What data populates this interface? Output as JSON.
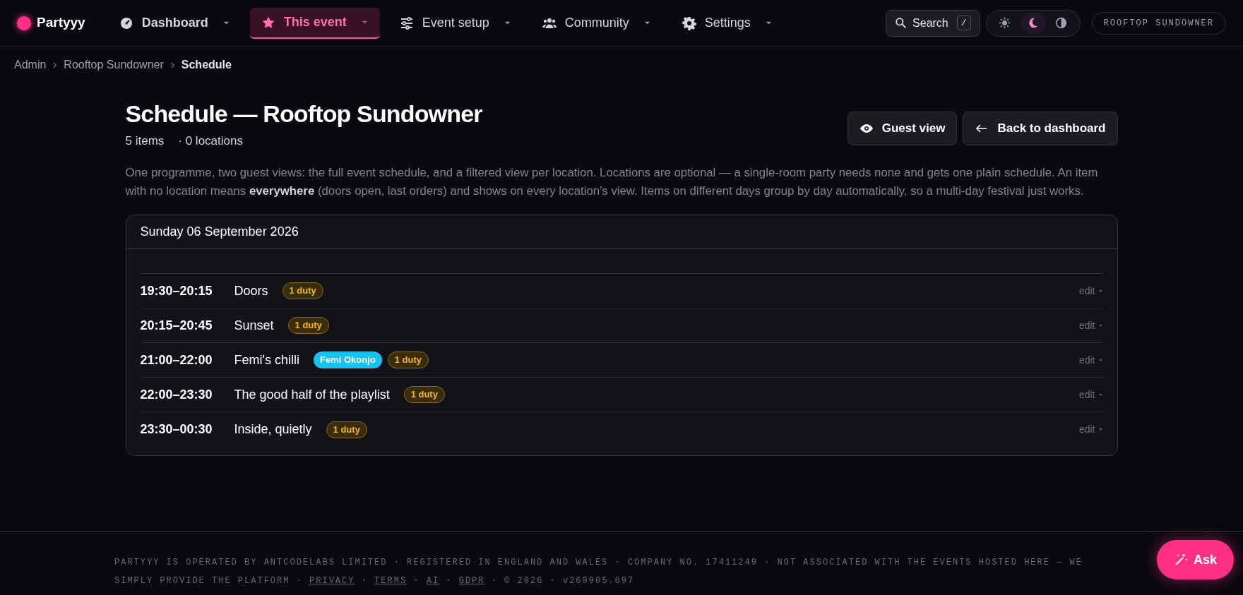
{
  "brand": {
    "name": "Partyyy"
  },
  "nav": [
    {
      "label": "Dashboard",
      "selected": false
    },
    {
      "label": "This event",
      "selected": true
    },
    {
      "label": "Event setup",
      "selected": false
    },
    {
      "label": "Community",
      "selected": false
    },
    {
      "label": "Settings",
      "selected": false
    }
  ],
  "search": {
    "label": "Search",
    "shortcut": "/"
  },
  "theme_options": [
    {
      "kind": "sun",
      "selected": false
    },
    {
      "kind": "moon",
      "selected": true
    },
    {
      "kind": "contrast",
      "selected": false
    }
  ],
  "event_chip": "ROOFTOP SUNDOWNER",
  "breadcrumb": [
    "Admin",
    "Rooftop Sundowner",
    "Schedule"
  ],
  "page": {
    "title": "Schedule — Rooftop Sundowner",
    "item_count": "5 items",
    "location_count": "· 0 locations",
    "description": "One programme, two guest views: the full event schedule, and a filtered view per location. Locations are optional — a single-room party needs none and gets one plain schedule. An item with no location means **everywhere** (doors open, last orders) and shows on every location's view. Items on different days group by day automatically, so a multi-day festival just works."
  },
  "actions": [
    {
      "label": "Guest view"
    },
    {
      "label": "Back to dashboard"
    }
  ],
  "schedule": {
    "day": "Sunday 06 September 2026",
    "items": [
      {
        "time": "19:30–20:15",
        "title": "Doors",
        "tags": [
          {
            "kind": "duty",
            "label": "1 duty"
          }
        ],
        "edit": "edit"
      },
      {
        "time": "20:15–20:45",
        "title": "Sunset",
        "tags": [
          {
            "kind": "duty",
            "label": "1 duty"
          }
        ],
        "edit": "edit"
      },
      {
        "time": "21:00–22:00",
        "title": "Femi's chilli",
        "tags": [
          {
            "kind": "person",
            "label": "Femi Okonjo"
          },
          {
            "kind": "duty",
            "label": "1 duty"
          }
        ],
        "edit": "edit"
      },
      {
        "time": "22:00–23:30",
        "title": "The good half of the playlist",
        "tags": [
          {
            "kind": "duty",
            "label": "1 duty"
          }
        ],
        "edit": "edit"
      },
      {
        "time": "23:30–00:30",
        "title": "Inside, quietly",
        "tags": [
          {
            "kind": "duty",
            "label": "1 duty"
          }
        ],
        "edit": "edit"
      }
    ]
  },
  "footer": [
    {
      "kind": "text",
      "text": "PARTYYY IS OPERATED BY ANTCODELABS LIMITED · REGISTERED IN ENGLAND AND WALES · COMPANY NO. 17411249 · NOT ASSOCIATED WITH THE EVENTS HOSTED HERE — WE SIMPLY PROVIDE THE PLATFORM · "
    },
    {
      "kind": "link",
      "text": "PRIVACY"
    },
    {
      "kind": "text",
      "text": " · "
    },
    {
      "kind": "link",
      "text": "TERMS"
    },
    {
      "kind": "text",
      "text": " · "
    },
    {
      "kind": "link",
      "text": "AI"
    },
    {
      "kind": "text",
      "text": " · "
    },
    {
      "kind": "link",
      "text": "GDPR"
    },
    {
      "kind": "text",
      "text": " · © 2026 · v260905.697"
    }
  ],
  "ask_button": "Ask"
}
